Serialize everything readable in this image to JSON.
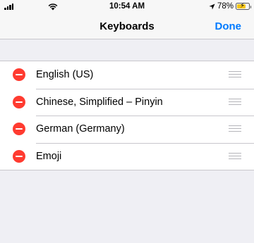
{
  "status": {
    "time": "10:54 AM",
    "battery_percent": "78%",
    "battery_level": 0.78
  },
  "nav": {
    "title": "Keyboards",
    "done_label": "Done"
  },
  "keyboards": [
    {
      "label": "English (US)"
    },
    {
      "label": "Chinese, Simplified – Pinyin"
    },
    {
      "label": "German (Germany)"
    },
    {
      "label": "Emoji"
    }
  ],
  "colors": {
    "accent": "#007aff",
    "delete": "#ff3b30",
    "background": "#efeff4"
  }
}
